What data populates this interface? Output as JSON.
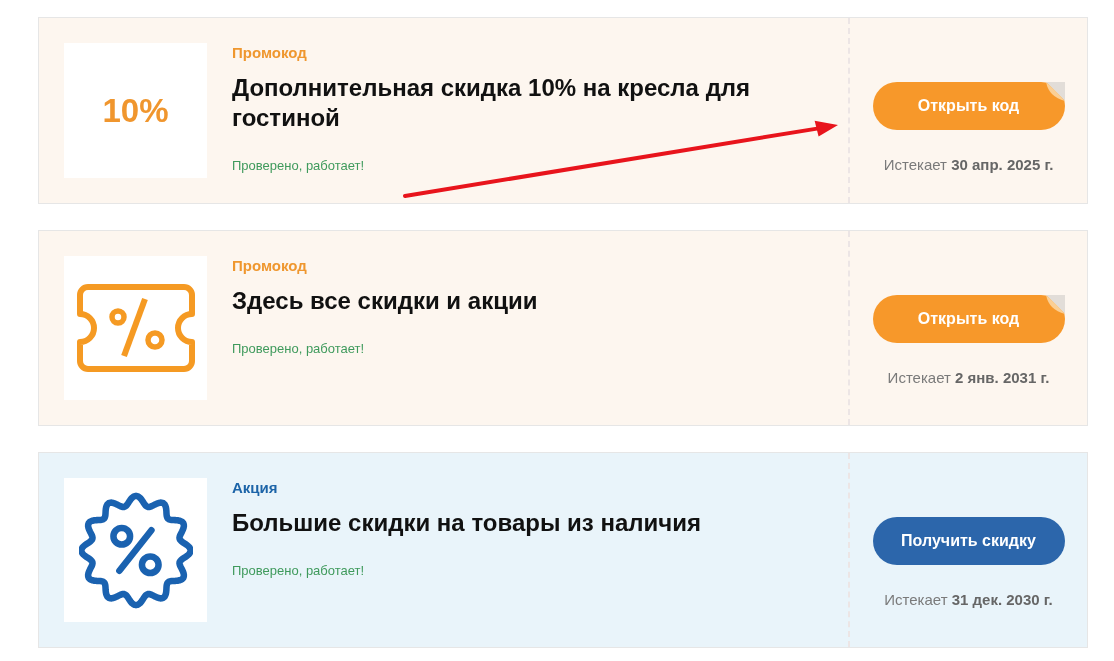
{
  "offers": [
    {
      "kind": "promocode",
      "logo": {
        "kind": "text",
        "text": "10%"
      },
      "label": "Промокод",
      "title": "Дополнительная скидка 10% на кресла для гостиной",
      "status": "Проверено, работает!",
      "button": "Открыть код",
      "expires": "Истекает **30 апр. 2025 г.**"
    },
    {
      "kind": "promocode",
      "logo": {
        "kind": "ticket"
      },
      "label": "Промокод",
      "title": "Здесь все скидки и акции",
      "status": "Проверено, работает!",
      "button": "Открыть код",
      "expires": "Истекает **2 янв. 2031 г.**"
    },
    {
      "kind": "deal",
      "logo": {
        "kind": "badge"
      },
      "label": "Акция",
      "title": "Большие скидки на товары из наличия",
      "status": "Проверено, работает!",
      "button": "Получить скидку",
      "expires": "Истекает **31 дек. 2030 г.**"
    }
  ]
}
